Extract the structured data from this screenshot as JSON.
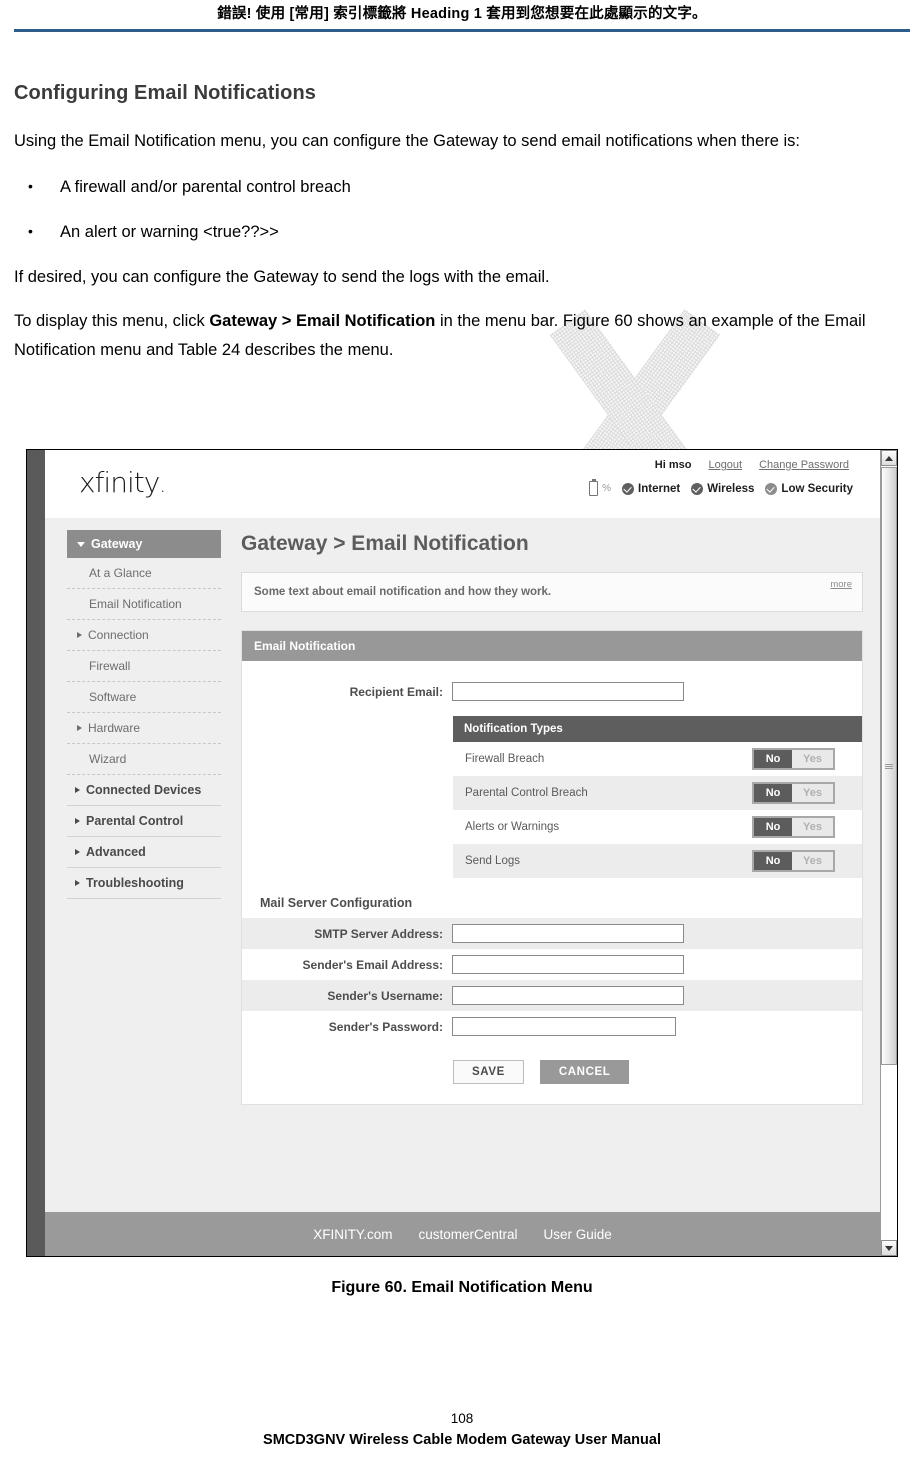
{
  "doc": {
    "running_header": "錯誤! 使用 [常用] 索引標籤將 Heading 1 套用到您想要在此處顯示的文字。",
    "section_title": "Configuring Email Notifications",
    "para1": "Using the Email Notification menu, you can configure the Gateway to send email notifications when there is:",
    "bullets": [
      "A firewall and/or parental control breach",
      "An alert or warning <true??>>"
    ],
    "para2": "If desired, you can configure the Gateway to send the logs with the email.",
    "para3_prefix": "To display this menu, click ",
    "para3_bold": "Gateway > Email Notification",
    "para3_suffix": " in the menu bar. Figure 60 shows an example of the Email Notification menu and Table 24 describes the menu.",
    "figure_caption": "Figure 60. Email Notification Menu",
    "page_number": "108",
    "footer": "SMCD3GNV Wireless Cable Modem Gateway User Manual"
  },
  "screenshot": {
    "brand": "xfinity",
    "account": {
      "greeting": "Hi mso",
      "logout": "Logout",
      "change_password": "Change Password"
    },
    "status": {
      "battery_pct": "%",
      "internet": "Internet",
      "wireless": "Wireless",
      "security": "Low Security"
    },
    "sidebar": {
      "top": "Gateway",
      "items": [
        {
          "label": "At a Glance",
          "arrow": false
        },
        {
          "label": "Email Notification",
          "arrow": false
        },
        {
          "label": "Connection",
          "arrow": true
        },
        {
          "label": "Firewall",
          "arrow": false
        },
        {
          "label": "Software",
          "arrow": false
        },
        {
          "label": "Hardware",
          "arrow": true
        },
        {
          "label": "Wizard",
          "arrow": false
        }
      ],
      "groups": [
        {
          "label": "Connected Devices"
        },
        {
          "label": "Parental Control"
        },
        {
          "label": "Advanced"
        },
        {
          "label": "Troubleshooting"
        }
      ]
    },
    "main": {
      "heading": "Gateway > Email Notification",
      "info_text": "Some text about email notification and how they work.",
      "more_link": "more",
      "panel_title": "Email Notification",
      "recipient_label": "Recipient Email:",
      "recipient_value": "",
      "notification_types_title": "Notification Types",
      "notification_types": [
        {
          "label": "Firewall Breach",
          "no": "No",
          "yes": "Yes",
          "selected": "No"
        },
        {
          "label": "Parental Control Breach",
          "no": "No",
          "yes": "Yes",
          "selected": "No"
        },
        {
          "label": "Alerts or Warnings",
          "no": "No",
          "yes": "Yes",
          "selected": "No"
        },
        {
          "label": "Send Logs",
          "no": "No",
          "yes": "Yes",
          "selected": "No"
        }
      ],
      "mail_server_title": "Mail Server Configuration",
      "mail_fields": [
        {
          "label": "SMTP Server Address:",
          "value": ""
        },
        {
          "label": "Sender's Email Address:",
          "value": ""
        },
        {
          "label": "Sender's Username:",
          "value": ""
        },
        {
          "label": "Sender's Password:",
          "value": ""
        }
      ],
      "save_label": "SAVE",
      "cancel_label": "CANCEL"
    },
    "footer_links": [
      "XFINITY.com",
      "customerCentral",
      "User Guide"
    ],
    "colors": {
      "rule": "#2e5c8a",
      "nav_active": "#8c8c8c",
      "panel_head": "#989898",
      "table_head": "#5e5e5e",
      "toggle_on": "#5c5c5c",
      "cancel": "#999999",
      "footer_bar": "#9a9a9a"
    }
  }
}
